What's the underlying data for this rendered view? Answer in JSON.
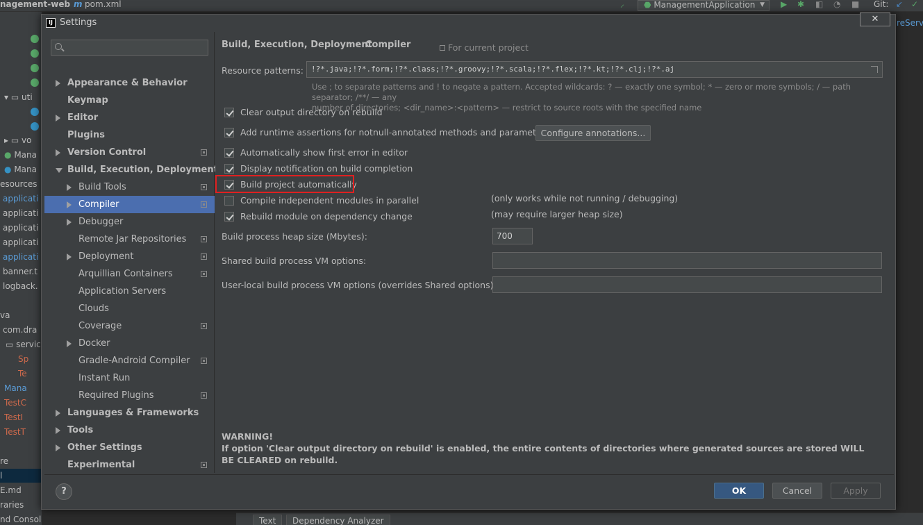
{
  "ide": {
    "project_name": "nagement-web",
    "file_tab": "pom.xml",
    "run_config": "ManagementApplication",
    "git_label": "Git:",
    "right_edge_text": "reServ",
    "tree_items": [
      "uti",
      "vo",
      "Mana",
      "Mana",
      "esources",
      "applicati",
      "applicati",
      "applicati",
      "applicati",
      "applicati",
      "banner.t",
      "logback.",
      "va",
      "com.dra",
      "servic",
      "Sp",
      "Te",
      "Mana",
      "TestC",
      "TestI",
      "TestT",
      "re",
      "l",
      "E.md",
      "raries",
      "nd Consoles"
    ],
    "bottom_tabs": [
      "Text",
      "Dependency Analyzer"
    ]
  },
  "dialog": {
    "title": "Settings",
    "close_label": "✕",
    "search": {
      "placeholder": ""
    },
    "tree": [
      {
        "label": "Appearance & Behavior",
        "bold": true,
        "arrow": "right",
        "indent": 0,
        "proj": false
      },
      {
        "label": "Keymap",
        "bold": true,
        "arrow": "",
        "indent": 0,
        "proj": false
      },
      {
        "label": "Editor",
        "bold": true,
        "arrow": "right",
        "indent": 0,
        "proj": false
      },
      {
        "label": "Plugins",
        "bold": true,
        "arrow": "",
        "indent": 0,
        "proj": false
      },
      {
        "label": "Version Control",
        "bold": true,
        "arrow": "right",
        "indent": 0,
        "proj": true
      },
      {
        "label": "Build, Execution, Deployment",
        "bold": true,
        "arrow": "down",
        "indent": 0,
        "proj": false
      },
      {
        "label": "Build Tools",
        "bold": false,
        "arrow": "right",
        "indent": 1,
        "proj": true
      },
      {
        "label": "Compiler",
        "bold": false,
        "arrow": "right",
        "indent": 1,
        "proj": true,
        "selected": true
      },
      {
        "label": "Debugger",
        "bold": false,
        "arrow": "right",
        "indent": 1,
        "proj": false
      },
      {
        "label": "Remote Jar Repositories",
        "bold": false,
        "arrow": "",
        "indent": 1,
        "proj": true
      },
      {
        "label": "Deployment",
        "bold": false,
        "arrow": "right",
        "indent": 1,
        "proj": true
      },
      {
        "label": "Arquillian Containers",
        "bold": false,
        "arrow": "",
        "indent": 1,
        "proj": true
      },
      {
        "label": "Application Servers",
        "bold": false,
        "arrow": "",
        "indent": 1,
        "proj": false
      },
      {
        "label": "Clouds",
        "bold": false,
        "arrow": "",
        "indent": 1,
        "proj": false
      },
      {
        "label": "Coverage",
        "bold": false,
        "arrow": "",
        "indent": 1,
        "proj": true
      },
      {
        "label": "Docker",
        "bold": false,
        "arrow": "right",
        "indent": 1,
        "proj": false
      },
      {
        "label": "Gradle-Android Compiler",
        "bold": false,
        "arrow": "",
        "indent": 1,
        "proj": true
      },
      {
        "label": "Instant Run",
        "bold": false,
        "arrow": "",
        "indent": 1,
        "proj": false
      },
      {
        "label": "Required Plugins",
        "bold": false,
        "arrow": "",
        "indent": 1,
        "proj": true
      },
      {
        "label": "Languages & Frameworks",
        "bold": true,
        "arrow": "right",
        "indent": 0,
        "proj": false
      },
      {
        "label": "Tools",
        "bold": true,
        "arrow": "right",
        "indent": 0,
        "proj": false
      },
      {
        "label": "Other Settings",
        "bold": true,
        "arrow": "right",
        "indent": 0,
        "proj": false
      },
      {
        "label": "Experimental",
        "bold": true,
        "arrow": "",
        "indent": 0,
        "proj": true
      }
    ],
    "breadcrumb": {
      "parent": "Build, Execution, Deployment",
      "separator": "›",
      "current": "Compiler"
    },
    "for_current_project": "For current project",
    "resource_patterns": {
      "label": "Resource patterns:",
      "value": "!?*.java;!?*.form;!?*.class;!?*.groovy;!?*.scala;!?*.flex;!?*.kt;!?*.clj;!?*.aj",
      "hint_line1": "Use ; to separate patterns and ! to negate a pattern. Accepted wildcards: ? — exactly one symbol; * — zero or more symbols; / — path separator; /**/ — any",
      "hint_line2": "number of directories; <dir_name>:<pattern> — restrict to source roots with the specified name"
    },
    "options": [
      {
        "label": "Clear output directory on rebuild",
        "checked": true
      },
      {
        "label": "Add runtime assertions for notnull-annotated methods and parameters",
        "checked": true
      },
      {
        "label": "Automatically show first error in editor",
        "checked": true
      },
      {
        "label": "Display notification on build completion",
        "checked": true
      },
      {
        "label": "Build project automatically",
        "checked": true
      },
      {
        "label": "Compile independent modules in parallel",
        "checked": false
      },
      {
        "label": "Rebuild module on dependency change",
        "checked": true
      }
    ],
    "configure_annotations": "Configure annotations...",
    "notes": {
      "build_auto": "(only works while not running / debugging)",
      "parallel": "(may require larger heap size)"
    },
    "heap": {
      "label": "Build process heap size (Mbytes):",
      "value": "700"
    },
    "shared_vm": {
      "label": "Shared build process VM options:",
      "value": ""
    },
    "user_vm": {
      "label": "User-local build process VM options (overrides Shared options):",
      "value": ""
    },
    "warning": {
      "title": "WARNING!",
      "text": "If option 'Clear output directory on rebuild' is enabled, the entire contents of directories where generated sources are stored WILL BE CLEARED on rebuild."
    },
    "buttons": {
      "help": "?",
      "ok": "OK",
      "cancel": "Cancel",
      "apply": "Apply"
    }
  }
}
